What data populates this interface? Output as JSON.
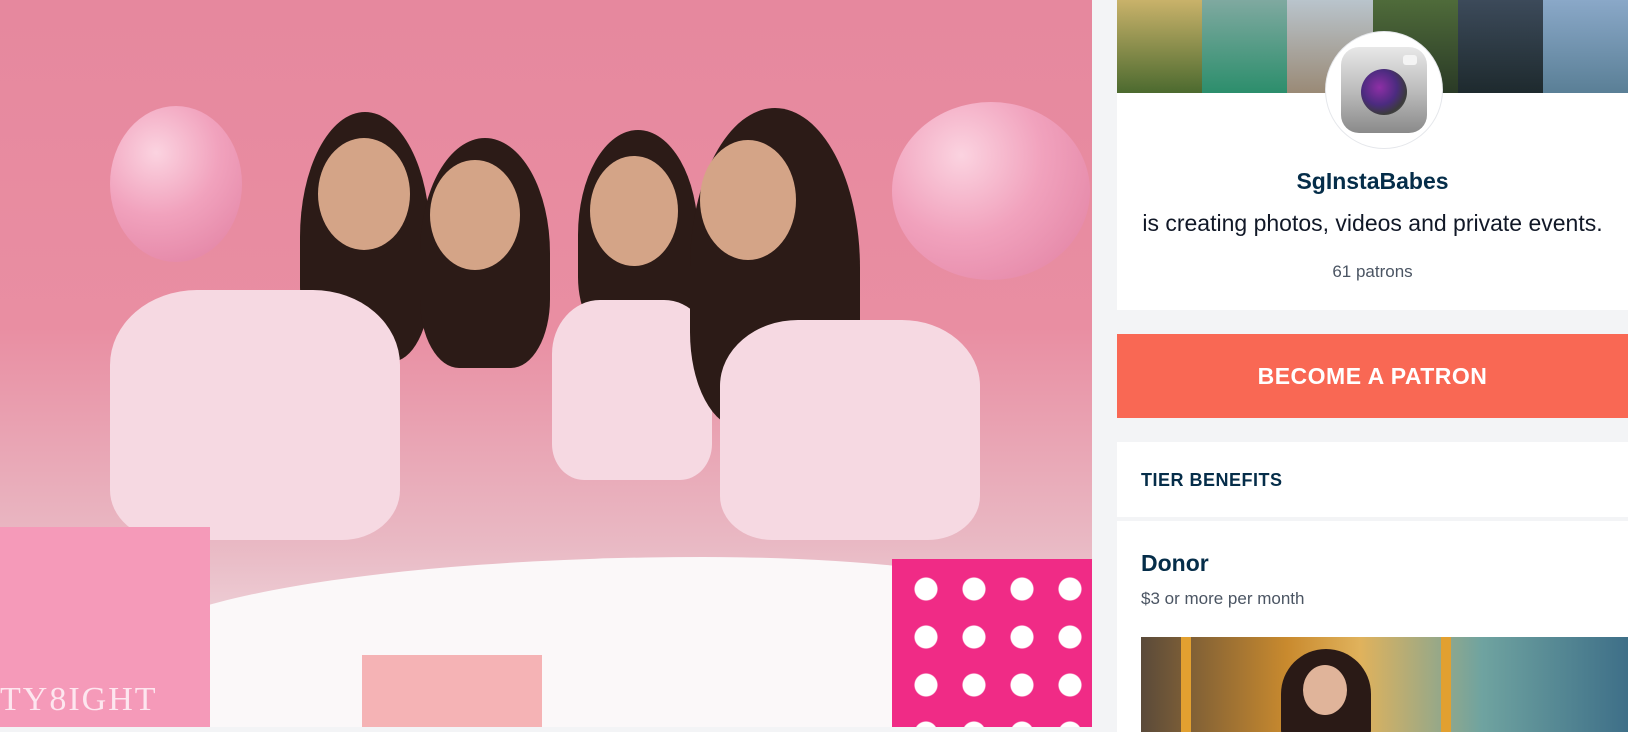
{
  "creator": {
    "name": "SgInstaBabes",
    "description": "is creating photos, videos and private events.",
    "patrons": "61 patrons",
    "avatar_icon": "instagram-camera-icon"
  },
  "actions": {
    "become_patron": "BECOME A PATRON"
  },
  "hero": {
    "bag_text": "TY8IGHT"
  },
  "tiers": {
    "heading": "TIER BENEFITS",
    "items": [
      {
        "name": "Donor",
        "price": "$3 or more per month"
      }
    ]
  },
  "colors": {
    "accent": "#f96854",
    "text_dark": "#052d49",
    "muted": "#4b5563",
    "page_bg": "#f3f4f6"
  }
}
